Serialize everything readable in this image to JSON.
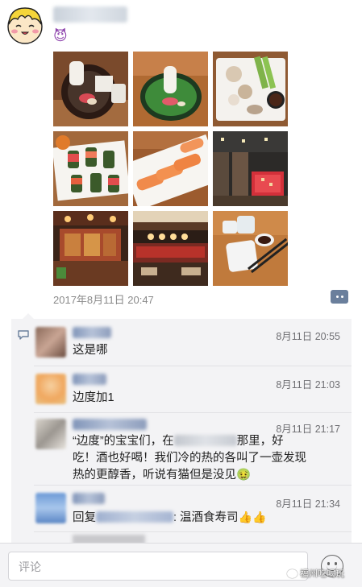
{
  "post": {
    "emoji": "😈",
    "timestamp": "2017年8月11日 20:47",
    "photos": [
      {
        "name": "photo-sake-appetizer"
      },
      {
        "name": "photo-sake-bottle-green-plate"
      },
      {
        "name": "photo-sashimi-platter"
      },
      {
        "name": "photo-sushi-rolls"
      },
      {
        "name": "photo-salmon-nigiri"
      },
      {
        "name": "photo-restaurant-interior"
      },
      {
        "name": "photo-restaurant-bar"
      },
      {
        "name": "photo-restaurant-counter"
      },
      {
        "name": "photo-soy-sauce-dish"
      }
    ]
  },
  "comments": [
    {
      "time": "8月11日 20:55",
      "text": "这是哪"
    },
    {
      "time": "8月11日 21:03",
      "text": "边度加1"
    },
    {
      "time": "8月11日 21:17",
      "text_a": "“边度”的宝宝们，在",
      "text_b": "那里，好",
      "text_c": "吃！酒也好喝！我们冷的热的各叫了一壶发现",
      "text_d": "热的更醇香，听说有猫但是没见🤢"
    },
    {
      "time": "8月11日 21:34",
      "reply_prefix": "回复",
      "text": ": 温酒食寿司",
      "thumbs": "👍👍"
    }
  ],
  "input": {
    "placeholder": "评论"
  },
  "watermark": {
    "text": "福州吃喝玩"
  }
}
